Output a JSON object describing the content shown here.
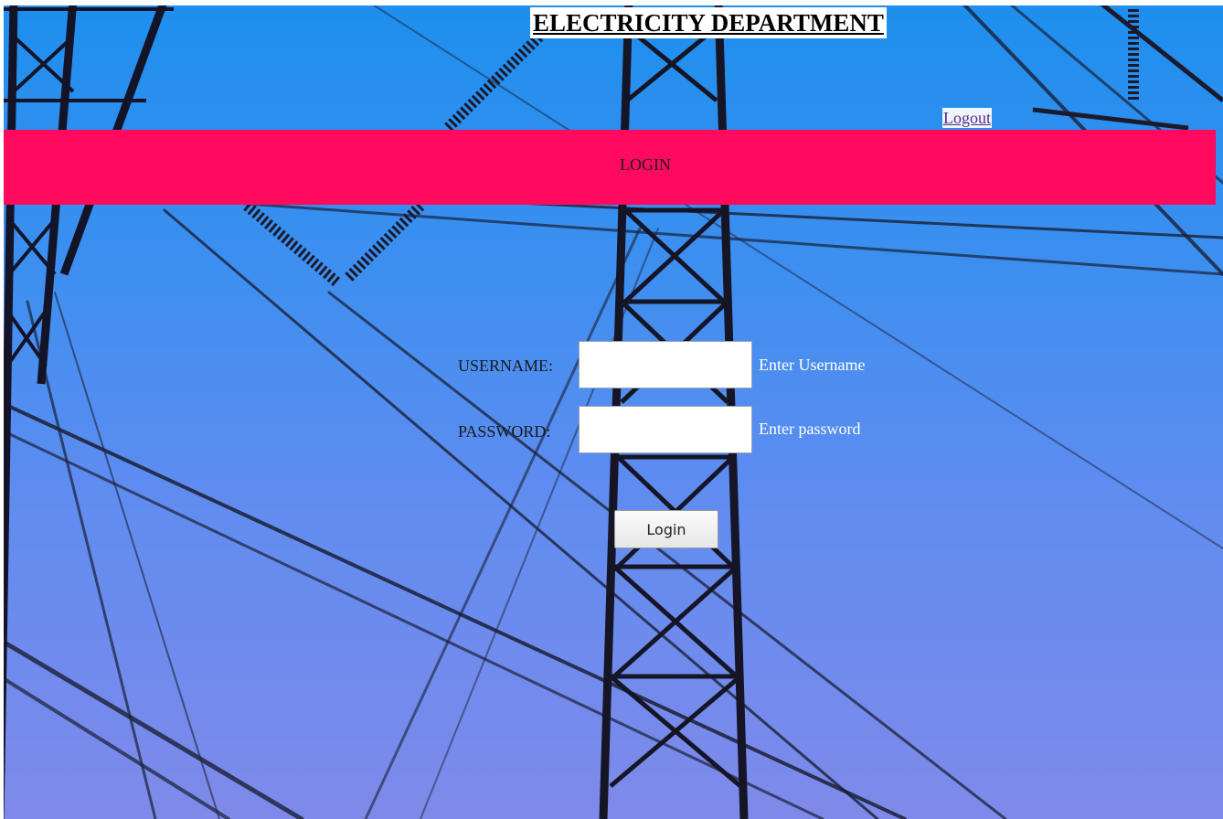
{
  "header": {
    "title": "ELECTRICITY DEPARTMENT",
    "logout_label": "Logout"
  },
  "banner": {
    "title": "LOGIN"
  },
  "form": {
    "username_label": "USERNAME:",
    "username_value": "",
    "username_hint": "Enter Username",
    "password_label": "PASSWORD:",
    "password_value": "",
    "password_hint": "Enter password",
    "submit_label": "Login"
  },
  "colors": {
    "banner": "#ff0a5e",
    "sky": "#3f8ff0",
    "hint_text": "#ffffff"
  },
  "background": {
    "description_icon": "power-transmission-tower-image"
  }
}
